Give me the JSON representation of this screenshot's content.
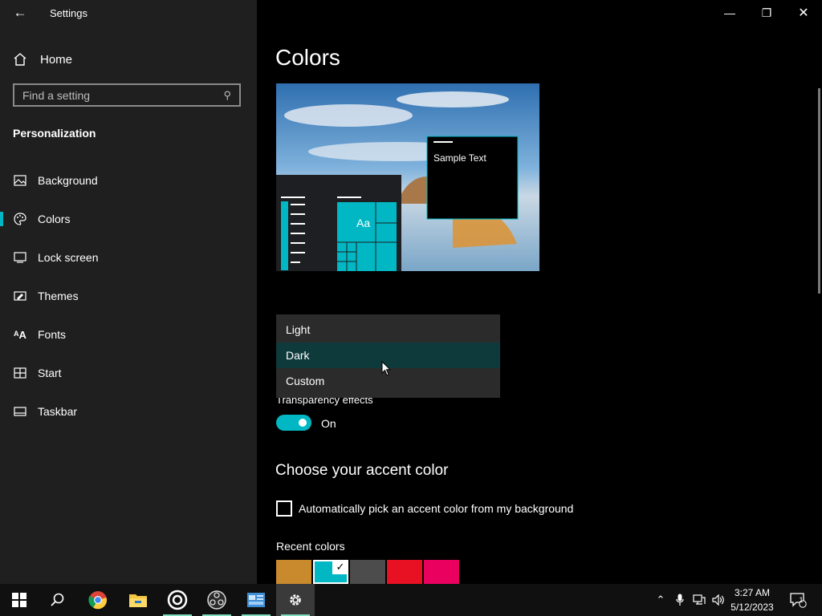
{
  "window": {
    "title": "Settings",
    "back_icon": "back-arrow-icon",
    "controls": [
      "minimize-icon",
      "restore-icon",
      "close-icon"
    ]
  },
  "sidebar": {
    "home_label": "Home",
    "search_placeholder": "Find a setting",
    "section_title": "Personalization",
    "items": [
      {
        "label": "Background",
        "icon": "picture-icon"
      },
      {
        "label": "Colors",
        "icon": "palette-icon",
        "active": true
      },
      {
        "label": "Lock screen",
        "icon": "lock-screen-icon"
      },
      {
        "label": "Themes",
        "icon": "brush-icon"
      },
      {
        "label": "Fonts",
        "icon": "font-icon"
      },
      {
        "label": "Start",
        "icon": "start-grid-icon"
      },
      {
        "label": "Taskbar",
        "icon": "taskbar-icon"
      }
    ]
  },
  "main": {
    "title": "Colors",
    "preview": {
      "sample_text": "Sample Text",
      "tile_text": "Aa"
    },
    "mode_dropdown": {
      "options": [
        "Light",
        "Dark",
        "Custom"
      ],
      "selected": "Dark"
    },
    "transparency": {
      "label": "Transparency effects",
      "state": "On"
    },
    "accent_heading": "Choose your accent color",
    "auto_pick_label": "Automatically pick an accent color from my background",
    "recent_colors_label": "Recent colors",
    "recent_colors": [
      "#c98a2e",
      "#00b7c3",
      "#4c4c4c",
      "#e81123",
      "#ea005e"
    ],
    "recent_selected_index": 1
  },
  "colors": {
    "accent": "#00b7c3",
    "sidebar_bg": "#1f1f1f",
    "main_bg": "#000000"
  },
  "taskbar": {
    "apps": [
      "windows-start-icon",
      "search-icon",
      "chrome-icon",
      "file-explorer-icon",
      "app-ring-icon",
      "obs-icon",
      "control-panel-icon",
      "settings-gear-icon"
    ],
    "clock": {
      "time": "3:27 AM",
      "date": "5/12/2023"
    },
    "notification_count": "1"
  }
}
